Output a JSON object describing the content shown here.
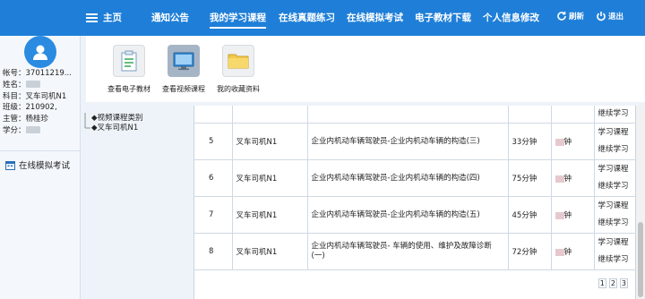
{
  "nav": {
    "home": "主页",
    "items": [
      "通知公告",
      "我的学习课程",
      "在线真题练习",
      "在线模拟考试",
      "电子教材下载",
      "个人信息修改"
    ],
    "active_index": 1,
    "refresh": "刷新",
    "logout": "退出"
  },
  "profile": {
    "account": "帐号：37011219...",
    "name": "姓名：",
    "subject": "科目：叉车司机N1",
    "class": "班级：210902,",
    "supervisor": "主管：杨桂珍",
    "credits": "学分："
  },
  "sidebar": {
    "mock_exam": "在线模拟考试"
  },
  "toolbar": {
    "items": [
      {
        "label": "查看电子教材",
        "icon": "clipboard-icon"
      },
      {
        "label": "查看视频课程",
        "icon": "monitor-icon"
      },
      {
        "label": "我的收藏资料",
        "icon": "folder-icon"
      }
    ],
    "selected_index": 1
  },
  "tree": {
    "root": "视频课程类别",
    "child": "叉车司机N1"
  },
  "table": {
    "top_partial_action": "继续学习",
    "rows": [
      {
        "num": "5",
        "name": "叉车司机N1",
        "title": "企业内机动车辆驾驶员-企业内机动车辆的构造(三)",
        "duration": "33分钟",
        "status": "钟",
        "actions": [
          "学习课程",
          "继续学习"
        ]
      },
      {
        "num": "6",
        "name": "叉车司机N1",
        "title": "企业内机动车辆驾驶员-企业内机动车辆的构造(四)",
        "duration": "75分钟",
        "status": "钟",
        "actions": [
          "学习课程",
          "继续学习"
        ]
      },
      {
        "num": "7",
        "name": "叉车司机N1",
        "title": "企业内机动车辆驾驶员-企业内机动车辆的构造(五)",
        "duration": "45分钟",
        "status": "钟",
        "actions": [
          "学习课程",
          "继续学习"
        ]
      },
      {
        "num": "8",
        "name": "叉车司机N1",
        "title": "企业内机动车辆驾驶员- 车辆的使用、维护及故障诊断(一)",
        "duration": "72分钟",
        "status": "钟",
        "actions": [
          "学习课程",
          "继续学习"
        ]
      }
    ]
  },
  "pager": [
    "1",
    "2",
    "3"
  ],
  "colors": {
    "nav_bg": "#1f7fd8",
    "avatar": "#2a8be0"
  }
}
